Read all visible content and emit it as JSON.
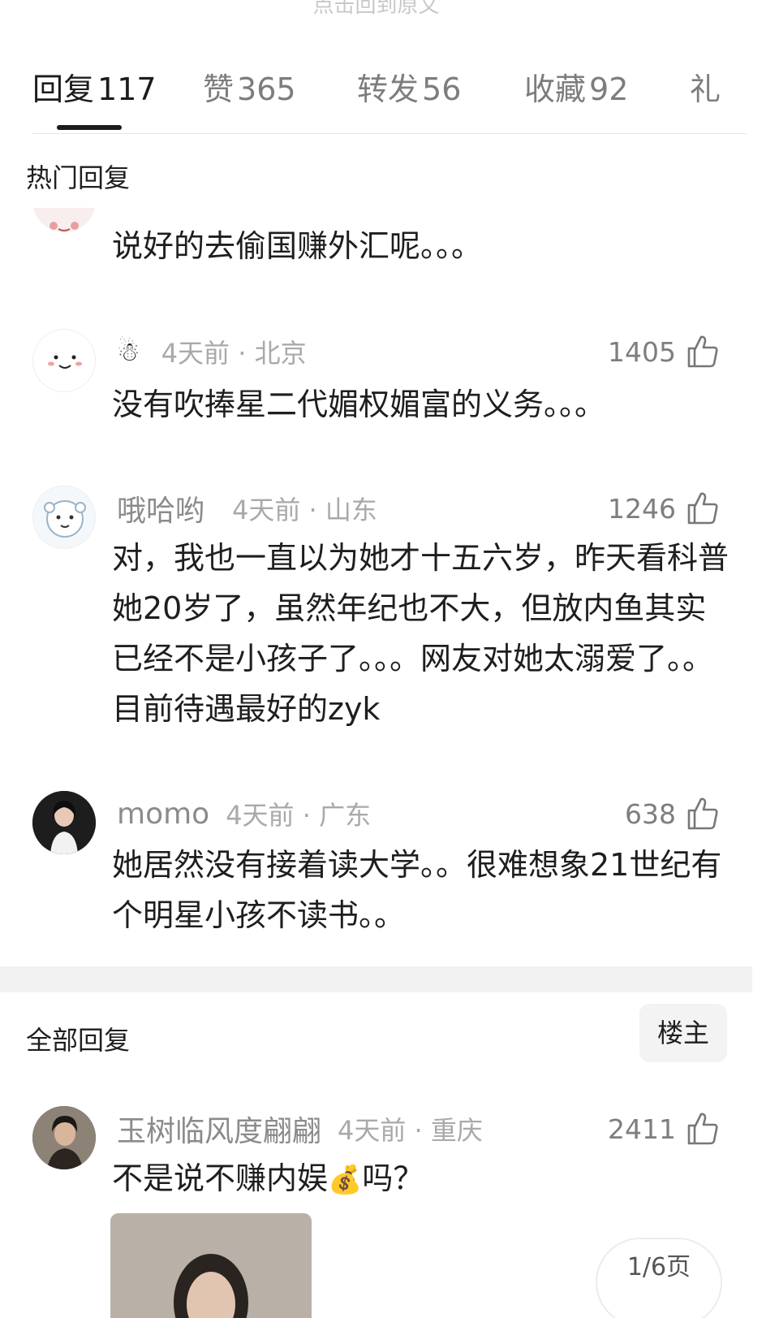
{
  "top_link": "点击回到原文",
  "tabs": [
    {
      "label": "回复",
      "count": "117"
    },
    {
      "label": "赞",
      "count": "365"
    },
    {
      "label": "转发",
      "count": "56"
    },
    {
      "label": "收藏",
      "count": "92"
    },
    {
      "label": "礼",
      "count": ""
    }
  ],
  "hot_section": {
    "title": "热门回复",
    "comments": [
      {
        "username": "",
        "time_loc": "",
        "likes": "",
        "text": "说好的去偷国赚外汇呢。。。"
      },
      {
        "username": "",
        "time_loc": "4天前 · 北京",
        "likes": "1405",
        "text": "没有吹捧星二代媚权媚富的义务。。。"
      },
      {
        "username": "哦哈哟",
        "time_loc": "4天前 · 山东",
        "likes": "1246",
        "text": "对，我也一直以为她才十五六岁，昨天看科普她20岁了，虽然年纪也不大，但放内鱼其实已经不是小孩子了。。。网友对她太溺爱了。。目前待遇最好的zyk"
      },
      {
        "username": "momo",
        "time_loc": "4天前 · 广东",
        "likes": "638",
        "text": "她居然没有接着读大学。。很难想象21世纪有个明星小孩不读书。。"
      }
    ]
  },
  "all_section": {
    "title": "全部回复",
    "op_button": "楼主",
    "comments": [
      {
        "username": "玉树临风度翩翩",
        "time_loc": "4天前 · 重庆",
        "likes": "2411",
        "text_before": "不是说不赚内娱",
        "text_after": "吗？"
      }
    ]
  },
  "page_indicator": "1/6页",
  "colors": {
    "text": "#1e1e1e",
    "meta": "#a9a9a9",
    "divider": "#e6e6e6"
  }
}
